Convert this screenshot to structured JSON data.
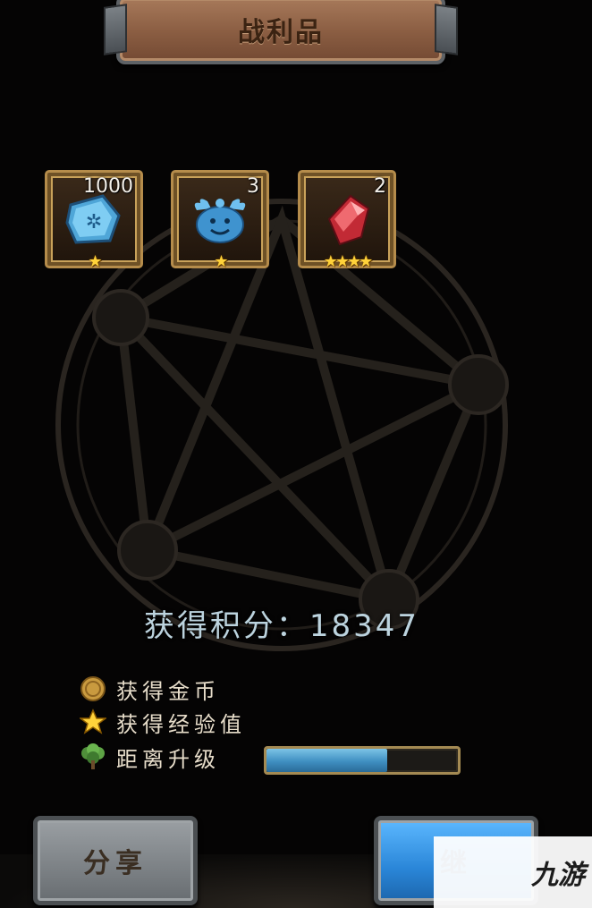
{
  "header": {
    "title": "战利品"
  },
  "loot": [
    {
      "count": "1000",
      "icon": "blue-rune-stone-icon",
      "stars": "★"
    },
    {
      "count": "3",
      "icon": "blue-slime-pet-icon",
      "stars": "★"
    },
    {
      "count": "2",
      "icon": "red-crystal-icon",
      "stars": "★★★★"
    }
  ],
  "score": {
    "label": "获得积分：18347"
  },
  "stats": {
    "gold": {
      "label": "获得金币",
      "icon": "gold-coin-icon"
    },
    "exp": {
      "label": "获得经验值",
      "icon": "star-icon"
    },
    "levelup": {
      "label": "距离升级",
      "icon": "tree-icon",
      "progress": 0.63
    }
  },
  "buttons": {
    "share": "分享",
    "next": "继"
  },
  "watermark": {
    "text": "九游"
  },
  "colors": {
    "progress": "#3f8fc1",
    "star": "#ffd23a",
    "next_button": "#2a86d8"
  }
}
